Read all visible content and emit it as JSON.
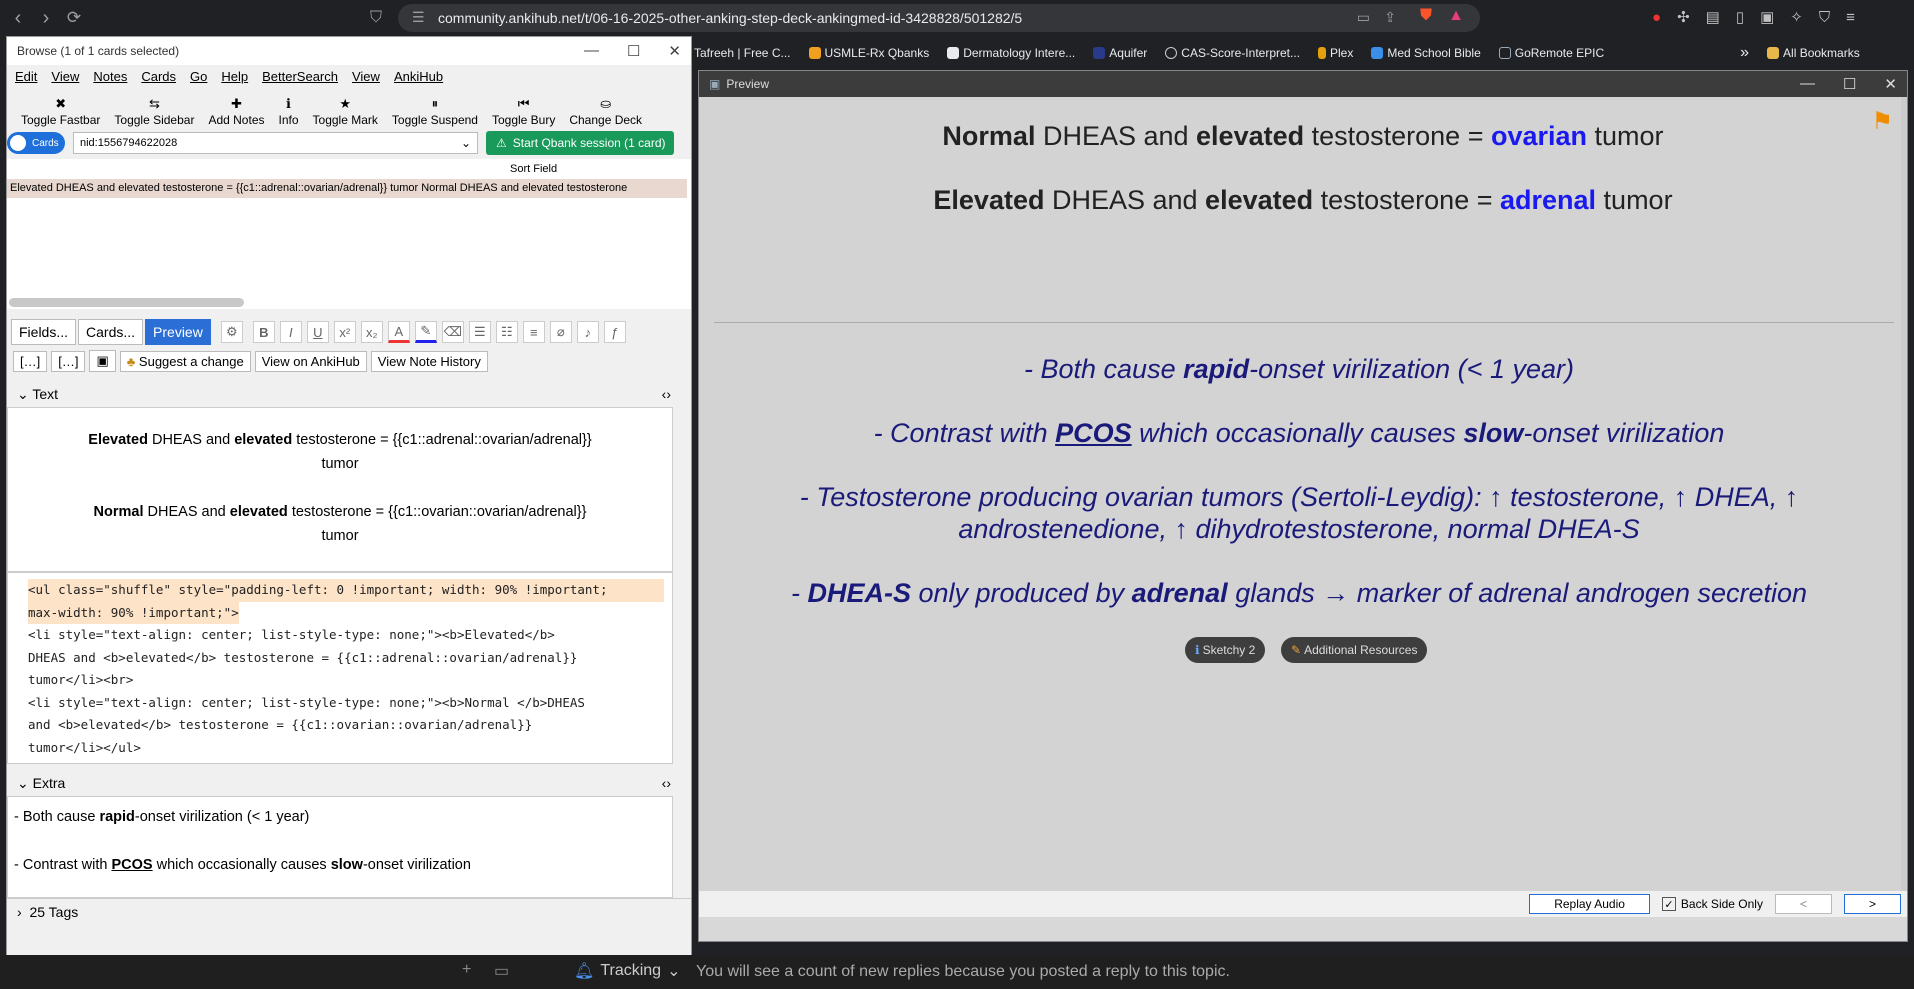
{
  "browser": {
    "url": "community.ankihub.net/t/06-16-2025-other-anking-step-deck-ankingmed-id-3428828/501282/5",
    "bookmarks": [
      "Tafreeh | Free C...",
      "USMLE-Rx Qbanks",
      "Dermatology Intere...",
      "Aquifer",
      "CAS-Score-Interpret...",
      "Plex",
      "Med School Bible",
      "GoRemote EPIC"
    ],
    "all_bookmarks": "All Bookmarks",
    "overflow": "»"
  },
  "browse": {
    "title": "Browse (1 of 1 cards selected)",
    "menu": [
      "Edit",
      "View",
      "Notes",
      "Cards",
      "Go",
      "Help",
      "BetterSearch",
      "View",
      "AnkiHub"
    ],
    "toolbar": [
      {
        "icon": "✖",
        "label": "Toggle Fastbar"
      },
      {
        "icon": "⇆",
        "label": "Toggle Sidebar"
      },
      {
        "icon": "✚",
        "label": "Add Notes"
      },
      {
        "icon": "ℹ",
        "label": "Info"
      },
      {
        "icon": "★",
        "label": "Toggle Mark"
      },
      {
        "icon": "⏸",
        "label": "Toggle Suspend"
      },
      {
        "icon": "⏮",
        "label": "Toggle Bury"
      },
      {
        "icon": "⛀",
        "label": "Change Deck"
      }
    ],
    "toggle_label": "Cards",
    "search_value": "nid:1556794622028",
    "qbank_label": "Start Qbank session (1 card)",
    "sort_field_header": "Sort Field",
    "card_row": "Elevated DHEAS and elevated testosterone = {{c1::adrenal::ovarian/adrenal}} tumor    Normal DHEAS and elevated testosterone",
    "editor_tabs": [
      "Fields...",
      "Cards...",
      "Preview"
    ],
    "format_buttons": [
      "B",
      "I",
      "U",
      "x²",
      "x₂",
      "A",
      "⌫"
    ],
    "note_buttons": [
      "Suggest a change",
      "View on AnkiHub",
      "View Note History"
    ],
    "text_field_label": "Text",
    "text_field": {
      "line1_b": "Elevated",
      "line1_mid": " DHEAS and ",
      "line1_b2": "elevated",
      "line1_end": " testosterone = {{c1::adrenal::ovarian/adrenal}}",
      "line1_tail": "tumor",
      "line2_b": "Normal",
      "line2_mid": " DHEAS and ",
      "line2_b2": "elevated",
      "line2_end": " testosterone = {{c1::ovarian::ovarian/adrenal}}",
      "line2_tail": "tumor"
    },
    "code_lines": [
      "<ul class=\"shuffle\" style=\"padding-left: 0 !important; width: 90% !important;",
      "max-width: 90% !important;\">",
      "  <li style=\"text-align: center; list-style-type: none;\"><b>Elevated</b>",
      "DHEAS and <b>elevated</b> testosterone = {{c1::adrenal::ovarian/adrenal}}",
      "tumor</li><br>",
      "  <li style=\"text-align: center; list-style-type: none;\"><b>Normal </b>DHEAS",
      "and <b>elevated</b> testosterone = {{c1::ovarian::ovarian/adrenal}}",
      "tumor</li></ul>"
    ],
    "extra_field_label": "Extra",
    "extra_line1_a": "- Both cause ",
    "extra_line1_b": "rapid",
    "extra_line1_c": "-onset virilization (< 1 year)",
    "extra_line2_a": "- Contrast with ",
    "extra_line2_b": "PCOS",
    "extra_line2_c": " which occasionally causes ",
    "extra_line2_d": "slow",
    "extra_line2_e": "-onset virilization",
    "tags": "25 Tags"
  },
  "preview": {
    "title": "Preview",
    "front1": {
      "b1": "Normal",
      "t1": " DHEAS and ",
      "b2": "elevated",
      "t2": " testosterone = ",
      "ans": "ovarian",
      "t3": " tumor"
    },
    "front2": {
      "b1": "Elevated",
      "t1": " DHEAS and ",
      "b2": "elevated",
      "t2": " testosterone = ",
      "ans": "adrenal",
      "t3": " tumor"
    },
    "extra1": {
      "a": "- Both cause ",
      "b": "rapid",
      "c": "-onset virilization (< 1 year)"
    },
    "extra2": {
      "a": "- Contrast with ",
      "b": "PCOS",
      "c": " which occasionally causes ",
      "d": "slow",
      "e": "-onset virilization"
    },
    "extra3a": "- Testosterone producing ovarian tumors (Sertoli-Leydig): ↑ testosterone, ↑ DHEA, ↑",
    "extra3b": "androstenedione, ↑ dihydrotestosterone, normal DHEA-S",
    "extra4": {
      "a": "- ",
      "b": "DHEA-S",
      "c": " only produced by ",
      "d": "adrenal",
      "e": " glands → marker of adrenal androgen secretion"
    },
    "pill1": "Sketchy 2",
    "pill2": "Additional Resources",
    "replay_audio": "Replay Audio",
    "back_side_only": "Back Side Only",
    "prev": "<",
    "next": ">"
  },
  "taskbar": {
    "tracking": "Tracking",
    "notice": "You will see a count of new replies because you posted a reply to this topic."
  },
  "colors": {
    "accent": "#1e6fd9",
    "answer_blue": "#1a1aee",
    "extra_navy": "#1a1a7a",
    "qbank_green": "#1a9a5a"
  }
}
